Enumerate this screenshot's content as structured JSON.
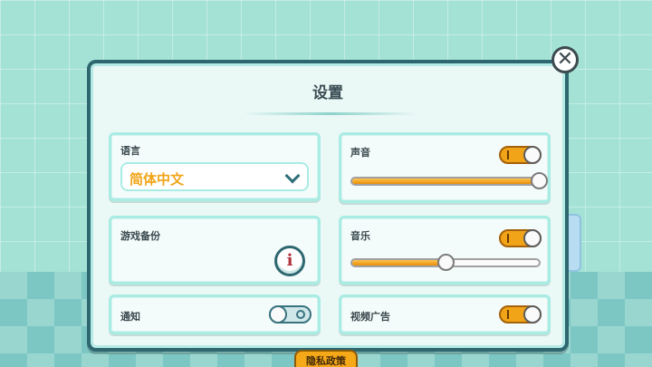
{
  "dialog": {
    "title": "设置"
  },
  "language": {
    "label": "语言",
    "value": "简体中文",
    "icon": "chevron-down-icon"
  },
  "backup": {
    "label": "游戏备份",
    "info_glyph": "i"
  },
  "notify": {
    "label": "通知",
    "enabled": false
  },
  "sound": {
    "label": "声音",
    "enabled": true,
    "volume": 1.0
  },
  "music": {
    "label": "音乐",
    "enabled": true,
    "volume": 0.5
  },
  "video_ads": {
    "label": "视频广告",
    "enabled": true
  },
  "close": {
    "glyph": "✕"
  },
  "privacy": {
    "label": "隐私政策"
  },
  "colors": {
    "accent": "#f1a417",
    "border": "#2f6771",
    "card_border": "#a9ece4"
  }
}
